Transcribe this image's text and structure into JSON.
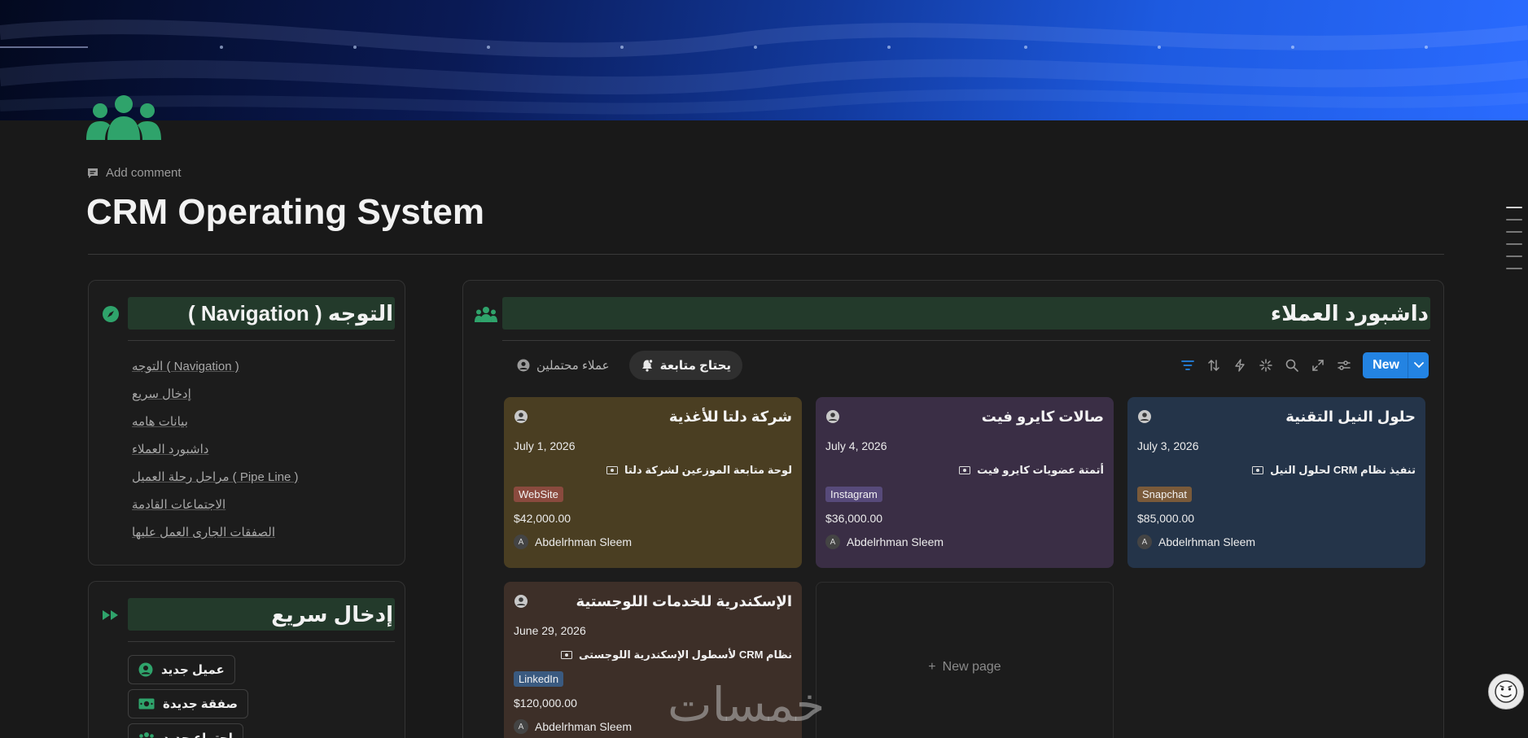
{
  "page": {
    "title": "CRM Operating System",
    "add_comment": "Add comment"
  },
  "navigation": {
    "heading": "التوجه ( Navigation )",
    "links": [
      "التوجه ( Navigation )",
      "إدخال سريع",
      "بيانات هامه",
      "داشبورد العملاء",
      "مراحل رحلة العميل ( Pipe Line )",
      "الاجتماعات القادمة",
      "الصفقات الجارى العمل عليها"
    ]
  },
  "quick_entry": {
    "heading": "إدخال سريع",
    "buttons": [
      "عميل جديد",
      "صفقة جديدة",
      "اجتماع جديد"
    ]
  },
  "dashboard": {
    "heading": "داشبورد العملاء",
    "views": [
      {
        "label": "يحتاج متابعة",
        "active": true
      },
      {
        "label": "عملاء محتملين",
        "active": false
      }
    ],
    "new_label": "New",
    "deals": [
      {
        "title": "حلول النيل التقنية",
        "date": "July 3, 2026",
        "description": "تنفيذ نظام CRM لحلول النيل",
        "source": "Snapchat",
        "source_color": "#7a5a3a",
        "amount": "$85,000.00",
        "owner": "Abdelrhman Sleem",
        "owner_initial": "A",
        "card_color": "#243449"
      },
      {
        "title": "صالات كايرو فيت",
        "date": "July 4, 2026",
        "description": "أتمتة عضويات كايرو فيت",
        "source": "Instagram",
        "source_color": "#574a7a",
        "amount": "$36,000.00",
        "owner": "Abdelrhman Sleem",
        "owner_initial": "A",
        "card_color": "#3a2e45"
      },
      {
        "title": "شركة دلتا للأغذية",
        "date": "July 1, 2026",
        "description": "لوحة متابعة الموزعين لشركة دلتا",
        "source": "WebSite",
        "source_color": "#8a4a3e",
        "amount": "$42,000.00",
        "owner": "Abdelrhman Sleem",
        "owner_initial": "A",
        "card_color": "#4a3e22"
      },
      {
        "title": "الإسكندرية للخدمات اللوجستية",
        "date": "June 29, 2026",
        "description": "نظام CRM لأسطول الإسكندرية اللوجستى",
        "source": "LinkedIn",
        "source_color": "#3a5a80",
        "amount": "$120,000.00",
        "owner": "Abdelrhman Sleem",
        "owner_initial": "A",
        "card_color": "#3d2f28"
      }
    ],
    "new_page_label": "New page"
  },
  "watermark": "خمسات",
  "colors": {
    "accent_green": "#2fa36b",
    "accent_blue": "#2383e2",
    "heading_bg": "#233a2b"
  }
}
